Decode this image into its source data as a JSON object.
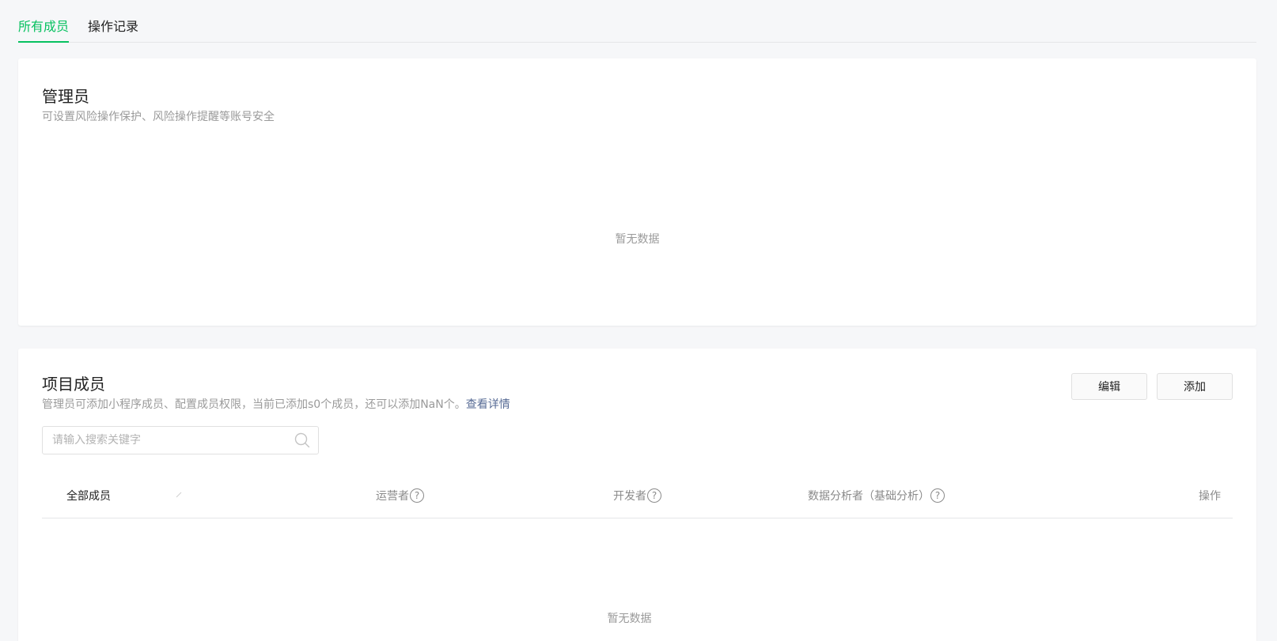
{
  "tabs": [
    {
      "label": "所有成员",
      "active": true
    },
    {
      "label": "操作记录",
      "active": false
    }
  ],
  "admin": {
    "title": "管理员",
    "desc": "可设置风险操作保护、风险操作提醒等账号安全",
    "empty": "暂无数据"
  },
  "members": {
    "title": "项目成员",
    "desc": "管理员可添加小程序成员、配置成员权限，当前已添加s0个成员，还可以添加NaN个。",
    "detail_link": "查看详情",
    "edit_button": "编辑",
    "add_button": "添加",
    "search_placeholder": "请输入搜索关键字",
    "columns": {
      "all": "全部成员",
      "operator": "运营者",
      "developer": "开发者",
      "analyst": "数据分析者（基础分析）",
      "action": "操作"
    },
    "help_glyph": "?",
    "empty": "暂无数据"
  },
  "colors": {
    "accent": "#07c160",
    "link": "#576b95"
  }
}
